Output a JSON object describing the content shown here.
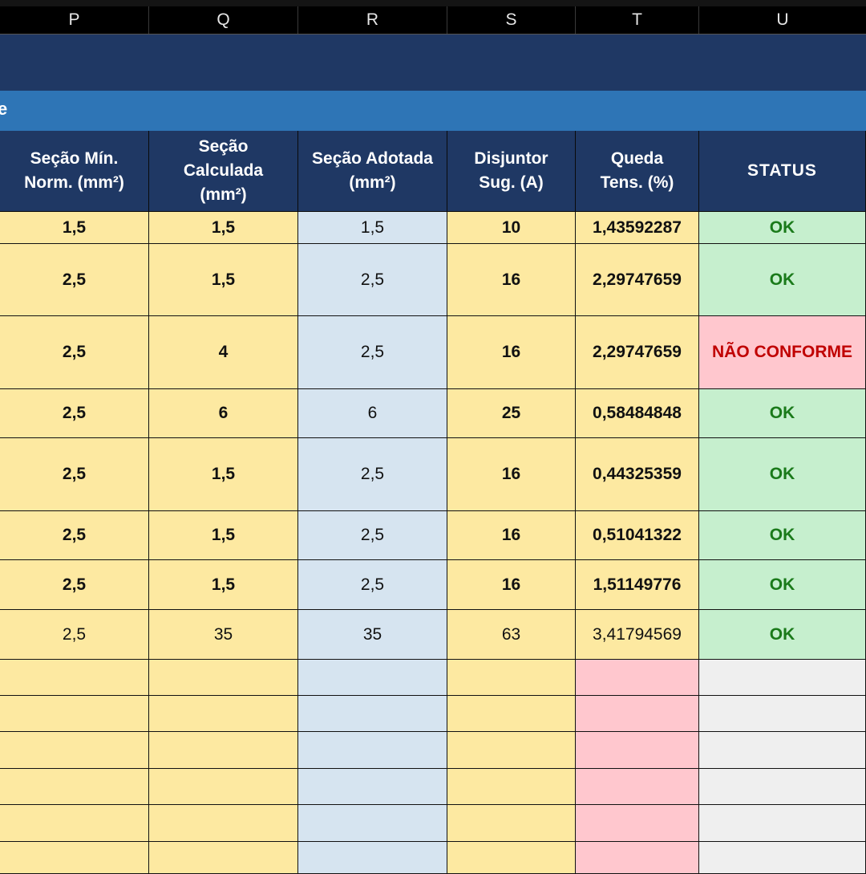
{
  "columns": [
    "P",
    "Q",
    "R",
    "S",
    "T",
    "U"
  ],
  "title_fragment": "e",
  "headers": {
    "p": "Seção Mín.\nNorm. (mm²)",
    "q": "Seção\nCalculada\n(mm²)",
    "r": "Seção Adotada\n(mm²)",
    "s": "Disjuntor\nSug. (A)",
    "t": "Queda\nTens. (%)",
    "u": "STATUS"
  },
  "rows": [
    {
      "secao_min": "1,5",
      "secao_calc": "1,5",
      "secao_adot": "1,5",
      "disjuntor": "10",
      "queda": "1,43592287",
      "status": "OK"
    },
    {
      "secao_min": "2,5",
      "secao_calc": "1,5",
      "secao_adot": "2,5",
      "disjuntor": "16",
      "queda": "2,29747659",
      "status": "OK"
    },
    {
      "secao_min": "2,5",
      "secao_calc": "4",
      "secao_adot": "2,5",
      "disjuntor": "16",
      "queda": "2,29747659",
      "status": "NÃO CONFORME"
    },
    {
      "secao_min": "2,5",
      "secao_calc": "6",
      "secao_adot": "6",
      "disjuntor": "25",
      "queda": "0,58484848",
      "status": "OK"
    },
    {
      "secao_min": "2,5",
      "secao_calc": "1,5",
      "secao_adot": "2,5",
      "disjuntor": "16",
      "queda": "0,44325359",
      "status": "OK"
    },
    {
      "secao_min": "2,5",
      "secao_calc": "1,5",
      "secao_adot": "2,5",
      "disjuntor": "16",
      "queda": "0,51041322",
      "status": "OK"
    },
    {
      "secao_min": "2,5",
      "secao_calc": "1,5",
      "secao_adot": "2,5",
      "disjuntor": "16",
      "queda": "1,51149776",
      "status": "OK"
    },
    {
      "secao_min": "2,5",
      "secao_calc": "35",
      "secao_adot": "35",
      "disjuntor": "63",
      "queda": "3,41794569",
      "status": "OK"
    }
  ],
  "colors": {
    "header_bg": "#1f3864",
    "band_blue": "#2e75b6",
    "yellow_fill": "#fde9a1",
    "blue_fill": "#d6e4f0",
    "ok_fill": "#c6efce",
    "ok_text": "#1a7a1a",
    "error_fill": "#ffc7ce",
    "error_text": "#c00000"
  }
}
